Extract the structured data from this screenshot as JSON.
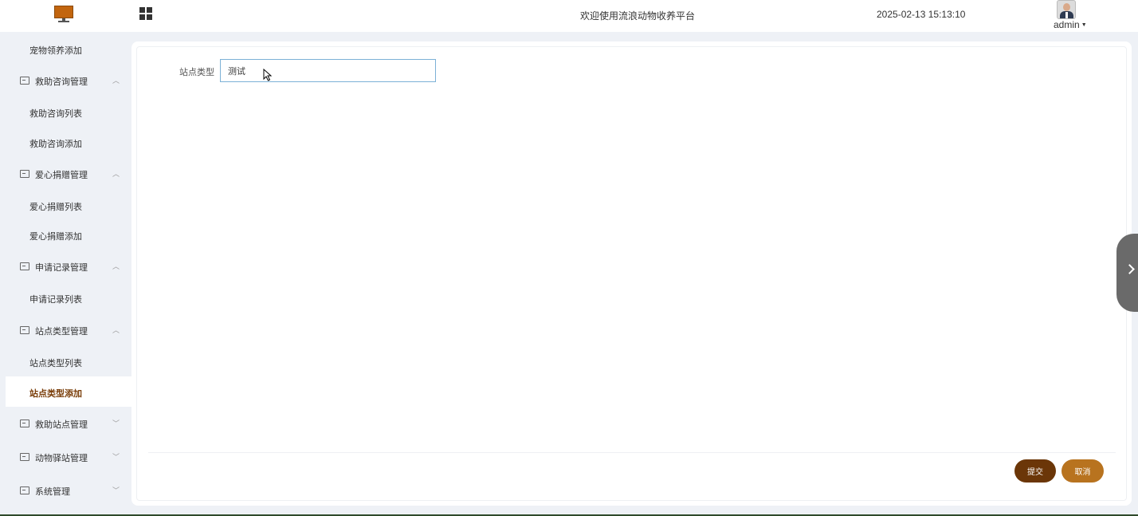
{
  "header": {
    "welcome_text": "欢迎使用流浪动物收养平台",
    "datetime": "2025-02-13 15:13:10",
    "user_name": "admin",
    "icons": {
      "logo": "monitor-logo",
      "menu_toggle": "grid-icon",
      "avatar": "user-avatar"
    }
  },
  "sidebar": {
    "items": [
      {
        "label": "宠物领养添加",
        "type": "sub"
      },
      {
        "label": "救助咨询管理",
        "type": "group",
        "expanded": true
      },
      {
        "label": "救助咨询列表",
        "type": "sub"
      },
      {
        "label": "救助咨询添加",
        "type": "sub"
      },
      {
        "label": "爱心捐赠管理",
        "type": "group",
        "expanded": true
      },
      {
        "label": "爱心捐赠列表",
        "type": "sub"
      },
      {
        "label": "爱心捐赠添加",
        "type": "sub"
      },
      {
        "label": "申请记录管理",
        "type": "group",
        "expanded": true
      },
      {
        "label": "申请记录列表",
        "type": "sub"
      },
      {
        "label": "站点类型管理",
        "type": "group",
        "expanded": true
      },
      {
        "label": "站点类型列表",
        "type": "sub"
      },
      {
        "label": "站点类型添加",
        "type": "sub",
        "active": true
      },
      {
        "label": "救助站点管理",
        "type": "group",
        "expanded": false
      },
      {
        "label": "动物驿站管理",
        "type": "group",
        "expanded": false
      },
      {
        "label": "系统管理",
        "type": "group",
        "expanded": false
      }
    ]
  },
  "form": {
    "field_label": "站点类型",
    "field_value": "测试",
    "submit_label": "提交",
    "cancel_label": "取消"
  },
  "colors": {
    "accent_dark": "#6b3608",
    "accent_light": "#b8731f",
    "active_menu_text": "#7a3e0a",
    "input_border": "#7cb1d6"
  }
}
